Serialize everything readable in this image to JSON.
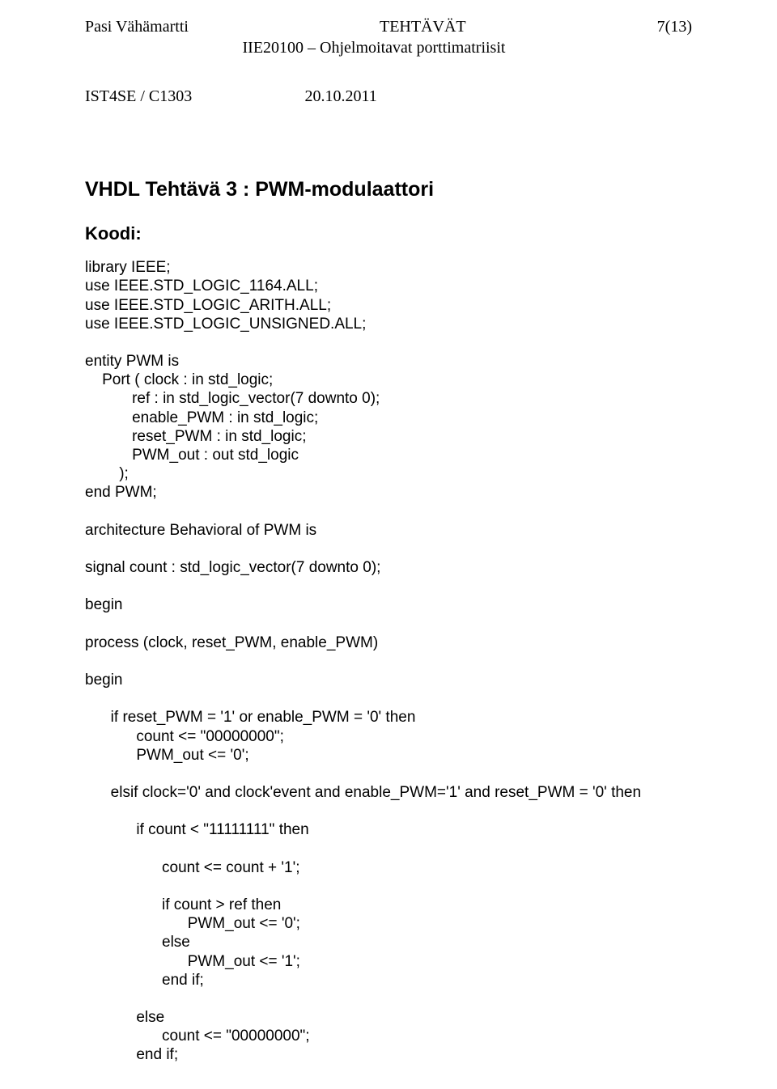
{
  "header": {
    "author": "Pasi Vähämartti",
    "doc_type": "TEHTÄVÄT",
    "page_num": "7(13)",
    "course_code": "IIE20100 – Ohjelmoitavat porttimatriisit",
    "sub_left": "IST4SE / C1303",
    "sub_date": "20.10.2011"
  },
  "title": "VHDL Tehtävä 3 : PWM-modulaattori",
  "koodi_label": "Koodi:",
  "code": "library IEEE;\nuse IEEE.STD_LOGIC_1164.ALL;\nuse IEEE.STD_LOGIC_ARITH.ALL;\nuse IEEE.STD_LOGIC_UNSIGNED.ALL;\n\nentity PWM is\n    Port ( clock : in std_logic;\n           ref : in std_logic_vector(7 downto 0);\n           enable_PWM : in std_logic;\n           reset_PWM : in std_logic;\n           PWM_out : out std_logic\n        );\nend PWM;\n\narchitecture Behavioral of PWM is\n\nsignal count : std_logic_vector(7 downto 0);\n\nbegin\n\nprocess (clock, reset_PWM, enable_PWM)\n\nbegin\n\n      if reset_PWM = '1' or enable_PWM = '0' then\n            count <= \"00000000\";\n            PWM_out <= '0';\n\n      elsif clock='0' and clock'event and enable_PWM='1' and reset_PWM = '0' then\n\n            if count < \"11111111\" then\n\n                  count <= count + '1';\n\n                  if count > ref then\n                        PWM_out <= '0';\n                  else\n                        PWM_out <= '1';\n                  end if;\n\n            else\n                  count <= \"00000000\";\n            end if;"
}
